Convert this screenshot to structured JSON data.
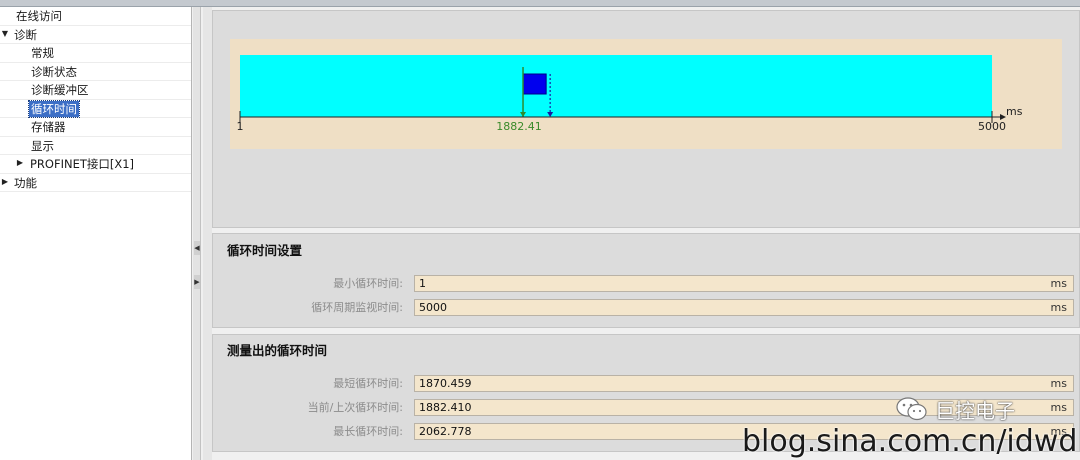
{
  "nav": {
    "items": [
      {
        "label": "在线访问",
        "indent": 0,
        "arrow": "",
        "selected": false
      },
      {
        "label": "诊断",
        "indent": 0,
        "arrow": "▼",
        "selected": false
      },
      {
        "label": "常规",
        "indent": 2,
        "arrow": "",
        "selected": false
      },
      {
        "label": "诊断状态",
        "indent": 2,
        "arrow": "",
        "selected": false
      },
      {
        "label": "诊断缓冲区",
        "indent": 2,
        "arrow": "",
        "selected": false
      },
      {
        "label": "循环时间",
        "indent": 2,
        "arrow": "",
        "selected": true
      },
      {
        "label": "存储器",
        "indent": 2,
        "arrow": "",
        "selected": false
      },
      {
        "label": "显示",
        "indent": 2,
        "arrow": "",
        "selected": false
      },
      {
        "label": "PROFINET接口[X1]",
        "indent": 1,
        "arrow": "▶",
        "selected": false
      },
      {
        "label": "功能",
        "indent": 0,
        "arrow": "▶",
        "selected": false
      }
    ]
  },
  "timeline": {
    "min": 1,
    "max": 5000,
    "min_label": "1",
    "max_label": "5000",
    "unit": "ms",
    "current": 1882.41,
    "current_label": "1882.41",
    "shortest": 1870.459,
    "longest": 2062.778,
    "colors": {
      "background": "#efdfc5",
      "range_fill": "#00ffff",
      "block_fill": "#0000ee",
      "current_marker": "#2e8b2e",
      "longest_marker": "#1a1aa0",
      "current_label": "#3a8a2a"
    }
  },
  "settings": {
    "title": "循环时间设置",
    "rows": [
      {
        "label": "最小循环时间:",
        "value": "1",
        "unit": "ms"
      },
      {
        "label": "循环周期监视时间:",
        "value": "5000",
        "unit": "ms"
      }
    ]
  },
  "measured": {
    "title": "测量出的循环时间",
    "rows": [
      {
        "label": "最短循环时间:",
        "value": "1870.459",
        "unit": "ms"
      },
      {
        "label": "当前/上次循环时间:",
        "value": "1882.410",
        "unit": "ms"
      },
      {
        "label": "最长循环时间:",
        "value": "2062.778",
        "unit": "ms"
      }
    ]
  },
  "watermark": {
    "brand": "巨控电子",
    "url": "blog.sina.com.cn/idwd"
  }
}
